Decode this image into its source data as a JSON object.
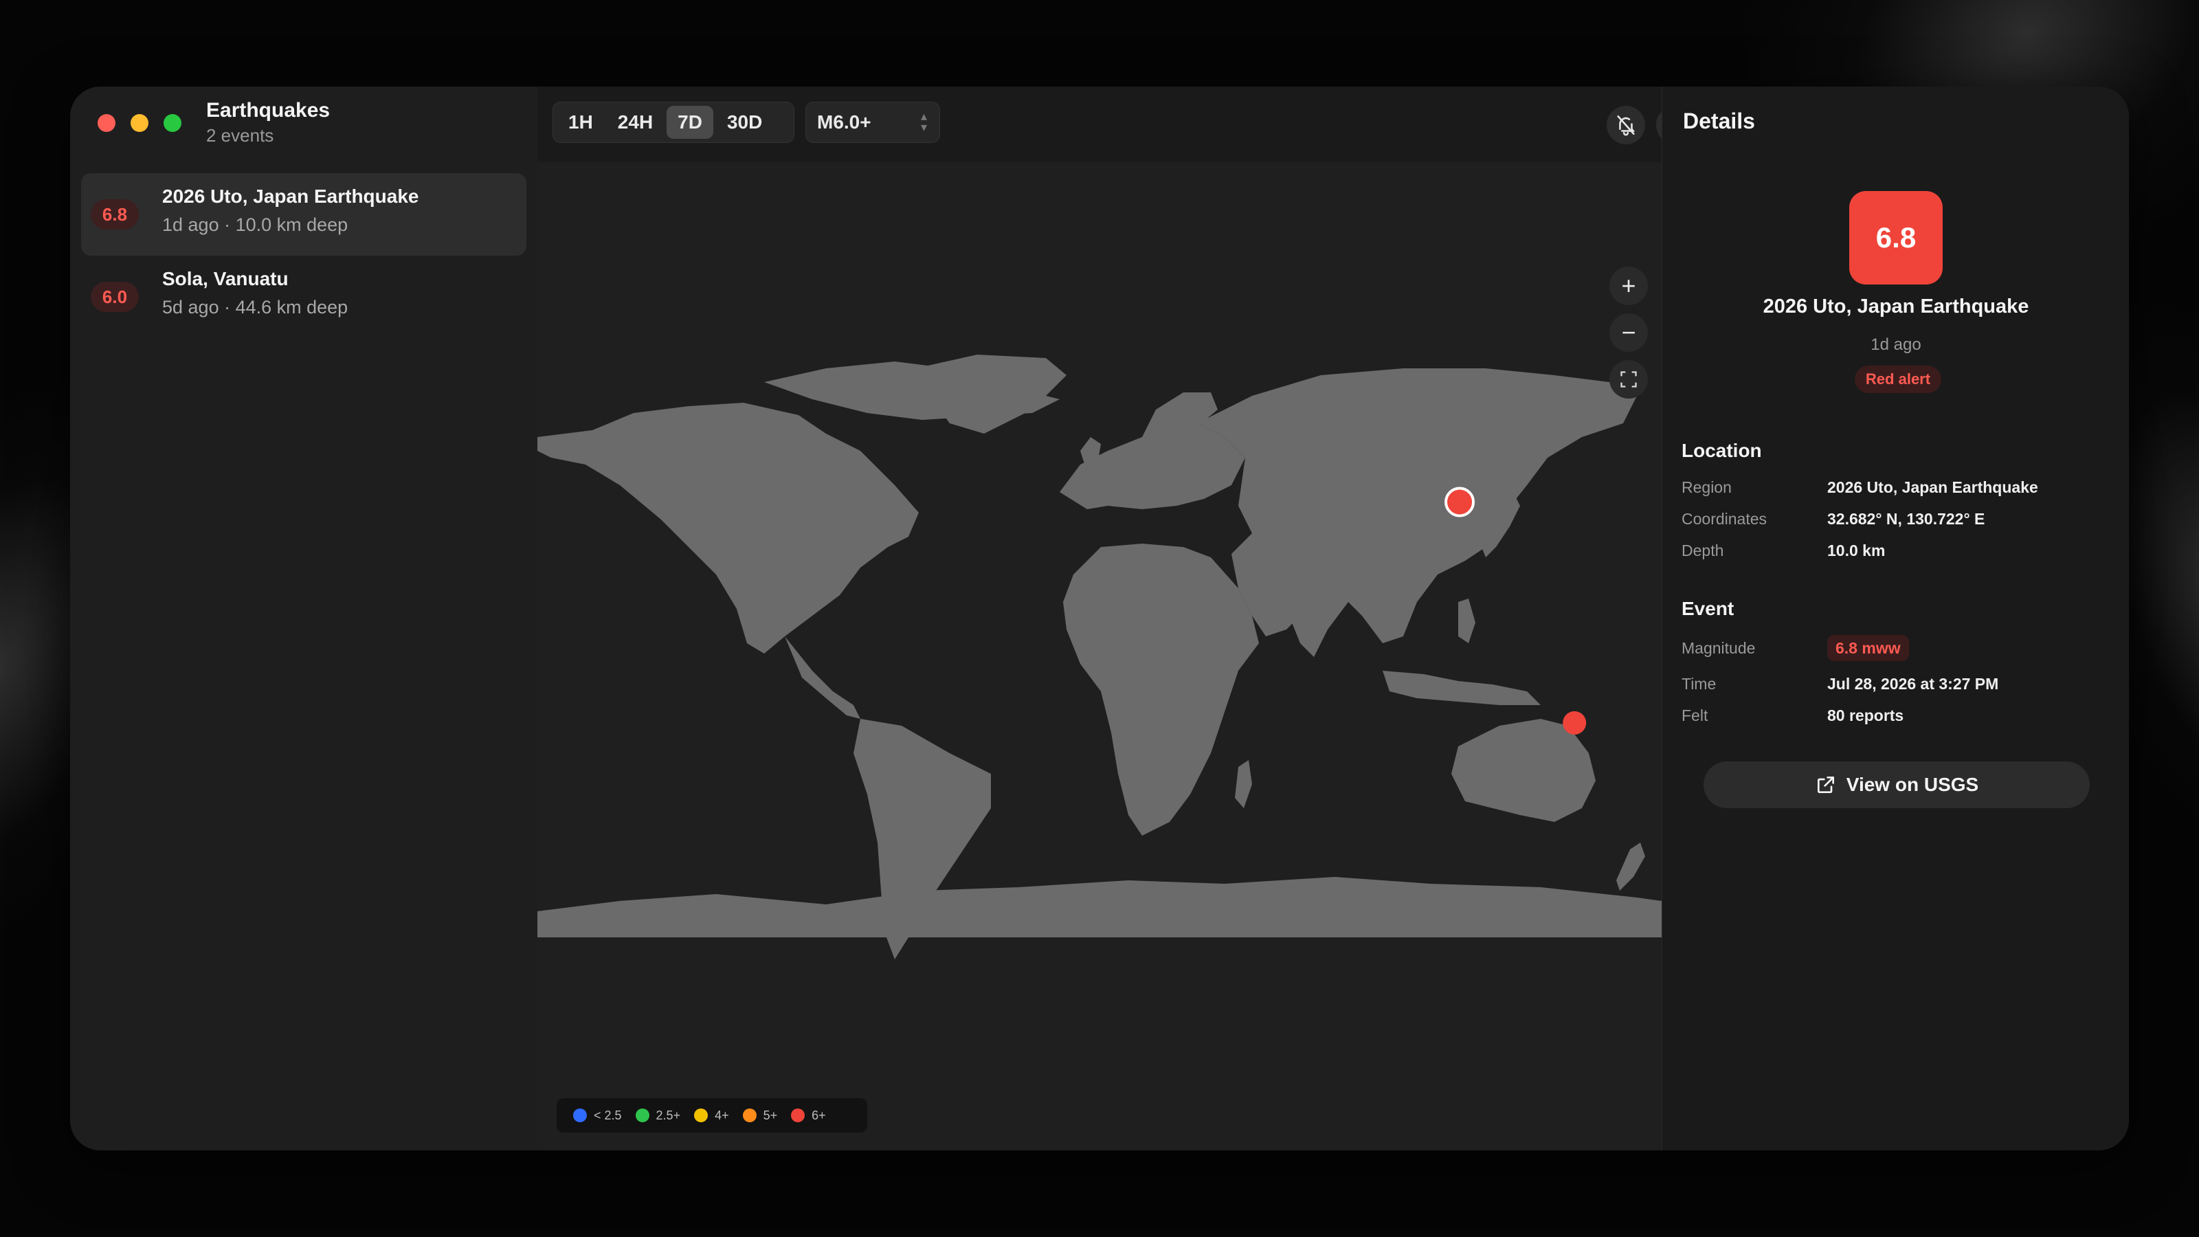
{
  "app": {
    "title": "Earthquakes",
    "event_count": "2 events"
  },
  "quakes": [
    {
      "magnitude": "6.8",
      "title": "2026 Uto, Japan Earthquake",
      "subtitle": "1d ago · 10.0 km deep",
      "selected": true
    },
    {
      "magnitude": "6.0",
      "title": "Sola, Vanuatu",
      "subtitle": "5d ago · 44.6 km deep",
      "selected": false
    }
  ],
  "toolbar": {
    "ranges": [
      "1H",
      "24H",
      "7D",
      "30D"
    ],
    "active_range": "7D",
    "magnitude_filter": "M6.0+",
    "mute_icon": "bell-slash-icon",
    "search_icon": "search-icon"
  },
  "map": {
    "zoom_in": "+",
    "zoom_out": "−",
    "legend": [
      {
        "label": "< 2.5",
        "color": "#2f6bff"
      },
      {
        "label": "2.5+",
        "color": "#2fc44d"
      },
      {
        "label": "4+",
        "color": "#f2c200"
      },
      {
        "label": "5+",
        "color": "#ff8c1a"
      },
      {
        "label": "6+",
        "color": "#f0443a"
      }
    ],
    "markers": [
      {
        "name": "2026 Uto, Japan Earthquake",
        "lat": 32.682,
        "lon": 130.722,
        "color": "#f0443a",
        "selected": true
      },
      {
        "name": "Sola, Vanuatu",
        "lat": -13.9,
        "lon": 167.5,
        "color": "#f0443a",
        "selected": false
      }
    ]
  },
  "details": {
    "header": "Details",
    "magnitude": "6.8",
    "name": "2026 Uto, Japan Earthquake",
    "ago": "1d ago",
    "alert": "Red alert",
    "location_header": "Location",
    "region_label": "Region",
    "region": "2026 Uto, Japan Earthquake",
    "coordinates_label": "Coordinates",
    "coordinates": "32.682° N, 130.722° E",
    "depth_label": "Depth",
    "depth": "10.0 km",
    "event_header": "Event",
    "magnitude_label": "Magnitude",
    "magnitude_value": "6.8 mww",
    "time_label": "Time",
    "time": "Jul 28, 2026 at 3:27 PM",
    "felt_label": "Felt",
    "felt": "80 reports",
    "usgs_button": "View on USGS"
  },
  "colors": {
    "accent_red": "#f0443a",
    "land": "#6b6b6b",
    "ocean": "#1f1f1f"
  }
}
